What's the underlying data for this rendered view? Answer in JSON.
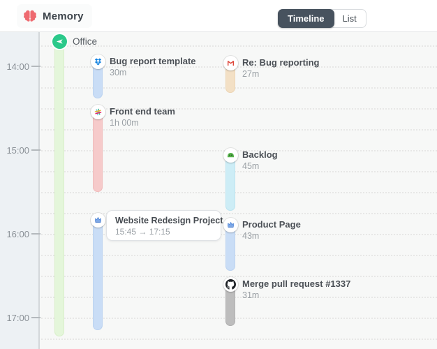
{
  "header": {
    "app_name": "Memory",
    "view_toggle": {
      "timeline_label": "Timeline",
      "list_label": "List",
      "active": "Timeline"
    }
  },
  "timeline": {
    "axis_times": [
      "14:00",
      "15:00",
      "16:00",
      "17:00"
    ],
    "track": {
      "label": "Office",
      "icon": "navigation-arrow-icon",
      "bar_color": "#e4f6da",
      "accent_color": "#2bc98a"
    },
    "entries": [
      {
        "title": "Bug report template",
        "duration": "30m",
        "app_icon": "dropbox-icon",
        "bar_color": "#c9ddf6"
      },
      {
        "title": "Front end team",
        "duration": "1h 00m",
        "app_icon": "slack-icon",
        "bar_color": "#f6caca"
      },
      {
        "title": "Website Redesign Project",
        "time_range": "15:45 → 17:15",
        "app_icon": "m-crown-icon",
        "bar_color": "#c9ddf6"
      },
      {
        "title": "Re: Bug reporting",
        "duration": "27m",
        "app_icon": "gmail-icon",
        "bar_color": "#f3e0c5"
      },
      {
        "title": "Backlog",
        "duration": "45m",
        "app_icon": "monster-icon",
        "bar_color": "#cdedf6"
      },
      {
        "title": "Product Page",
        "duration": "43m",
        "app_icon": "m-crown-icon",
        "bar_color": "#c9ddf6"
      },
      {
        "title": "Merge pull request #1337",
        "duration": "31m",
        "app_icon": "github-icon",
        "bar_color": "#bdbdbd"
      }
    ]
  },
  "colors": {
    "brand_pink": "#ee6a70",
    "toggle_dark": "#47525e",
    "gutter_bg": "#edf1f4",
    "chart_bg": "#f7f8f7",
    "accent_green": "#2bc98a"
  }
}
